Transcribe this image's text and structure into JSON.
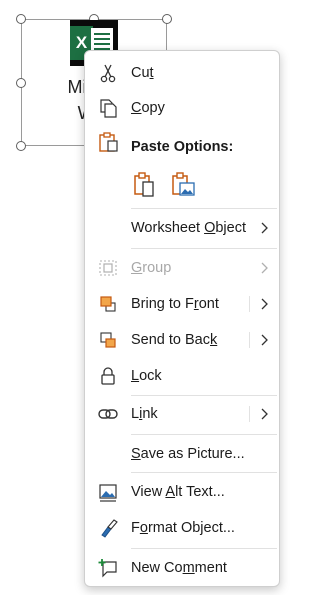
{
  "object": {
    "label_line1": "Micros",
    "label_line2": "Wor"
  },
  "menu": {
    "cut": {
      "pre": "Cu",
      "key": "t",
      "post": ""
    },
    "copy": {
      "pre": "",
      "key": "C",
      "post": "opy"
    },
    "paste_header": "Paste Options:",
    "worksheet_object": {
      "pre": "Worksheet ",
      "key": "O",
      "post": "bject"
    },
    "group": {
      "pre": "",
      "key": "G",
      "post": "roup"
    },
    "bring_to_front": {
      "pre": "Bring to F",
      "key": "r",
      "post": "ont"
    },
    "send_to_back": {
      "pre": "Send to Bac",
      "key": "k",
      "post": ""
    },
    "lock": {
      "pre": "",
      "key": "L",
      "post": "ock"
    },
    "link": {
      "pre": "L",
      "key": "i",
      "post": "nk"
    },
    "save_as_picture": {
      "pre": "",
      "key": "S",
      "post": "ave as Picture..."
    },
    "view_alt_text": {
      "pre": "View ",
      "key": "A",
      "post": "lt Text..."
    },
    "format_object": {
      "pre": "F",
      "key": "o",
      "post": "rmat Object..."
    },
    "new_comment": {
      "pre": "New Co",
      "key": "m",
      "post": "ment"
    }
  },
  "colors": {
    "accent_orange": "#c55a11",
    "excel_green": "#1d6f42",
    "icon_blue": "#2b6cb0",
    "disabled_text": "#a8a8a8"
  }
}
